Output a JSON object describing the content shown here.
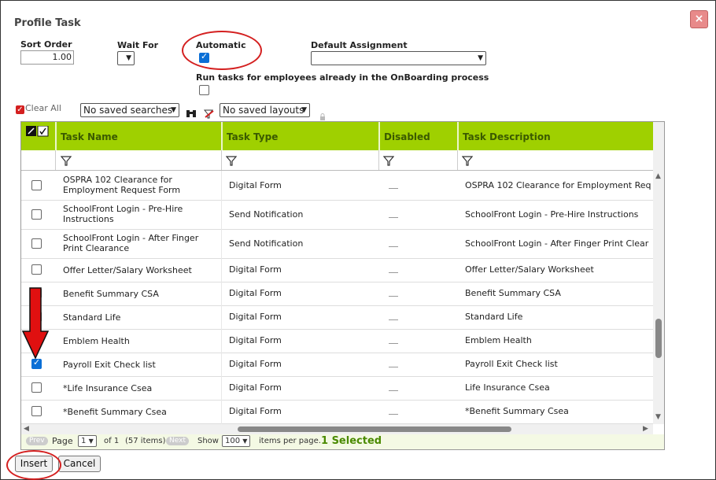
{
  "dialog": {
    "title": "Profile Task",
    "close_icon": "×"
  },
  "form": {
    "sort_order_label": "Sort Order",
    "sort_order_value": "1.00",
    "wait_for_label": "Wait For",
    "automatic_label": "Automatic",
    "automatic_checked": true,
    "default_assignment_label": "Default Assignment",
    "run_tasks_label": "Run tasks for employees already in the OnBoarding process"
  },
  "toolbar": {
    "clear_all_label": "Clear All",
    "saved_searches_value": "No saved searches",
    "saved_layouts_value": "No saved layouts"
  },
  "grid": {
    "columns": [
      "Task Name",
      "Task Type",
      "Disabled",
      "Task Description"
    ],
    "rows": [
      {
        "name": "OSPRA 102 Clearance for Employment Request Form",
        "type": "Digital Form",
        "description": "OSPRA 102 Clearance for Employment Req",
        "checked": false
      },
      {
        "name": "SchoolFront Login - Pre-Hire Instructions",
        "type": "Send Notification",
        "description": "SchoolFront Login - Pre-Hire Instructions",
        "checked": false
      },
      {
        "name": "SchoolFront Login - After Finger Print Clearance",
        "type": "Send Notification",
        "description": "SchoolFront Login - After Finger Print Clear",
        "checked": false
      },
      {
        "name": "Offer Letter/Salary Worksheet",
        "type": "Digital Form",
        "description": "Offer Letter/Salary Worksheet",
        "checked": false
      },
      {
        "name": "Benefit Summary CSA",
        "type": "Digital Form",
        "description": "Benefit Summary CSA",
        "checked": false
      },
      {
        "name": "Standard Life",
        "type": "Digital Form",
        "description": "Standard Life",
        "checked": false
      },
      {
        "name": "Emblem Health",
        "type": "Digital Form",
        "description": "Emblem Health",
        "checked": false
      },
      {
        "name": "Payroll Exit Check list",
        "type": "Digital Form",
        "description": "Payroll Exit Check list",
        "checked": true
      },
      {
        "name": "*Life Insurance Csea",
        "type": "Digital Form",
        "description": "Life Insurance Csea",
        "checked": false
      },
      {
        "name": "*Benefit Summary Csea",
        "type": "Digital Form",
        "description": "*Benefit Summary Csea",
        "checked": false
      }
    ]
  },
  "pager": {
    "prev": "Prev",
    "page_label": "Page",
    "page_value": "1",
    "of_text": "of 1",
    "items_text": "(57 items)",
    "next": "Next",
    "show_label": "Show",
    "per_page_value": "100",
    "per_page_label": "items per page.",
    "selected_text": "1 Selected"
  },
  "buttons": {
    "insert": "Insert",
    "cancel": "Cancel"
  },
  "colors": {
    "header_green": "#9fd000",
    "annotation_red": "#d42020"
  }
}
